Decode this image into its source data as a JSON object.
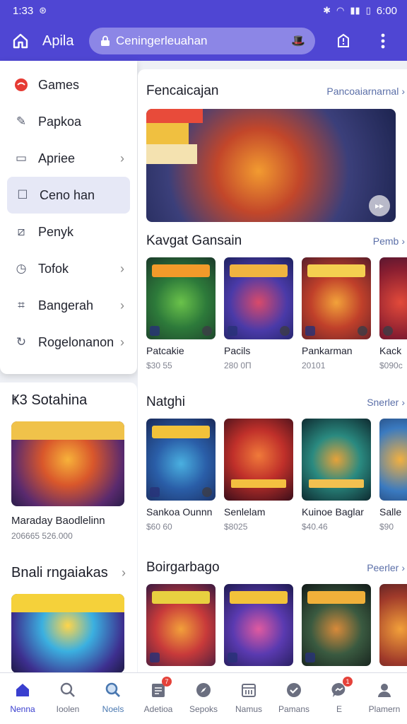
{
  "status": {
    "time": "1:33",
    "clock": "6:00"
  },
  "appbar": {
    "title": "Apila",
    "search_placeholder": "Ceningerleuahan"
  },
  "drawer": {
    "items": [
      {
        "label": "Games",
        "icon": "games-icon",
        "chevron": false
      },
      {
        "label": "Papkoa",
        "icon": "edit-icon",
        "chevron": false
      },
      {
        "label": "Apriee",
        "icon": "window-icon",
        "chevron": true
      },
      {
        "label": "Ceno han",
        "icon": "chat-icon",
        "chevron": false,
        "active": true
      },
      {
        "label": "Penyk",
        "icon": "chart-icon",
        "chevron": false
      },
      {
        "label": "Tofok",
        "icon": "clock-icon",
        "chevron": true
      },
      {
        "label": "Bangerah",
        "icon": "crop-icon",
        "chevron": true
      },
      {
        "label": "Rogelonanon",
        "icon": "refresh-icon",
        "chevron": true
      }
    ]
  },
  "leftcard": {
    "title": "Ҝ3 Sotahina",
    "item_name": "Maraday Baodlelinn",
    "item_meta": "206665  526.000",
    "title2": "Bnali rngaiakas"
  },
  "main": {
    "featured": {
      "title": "Fencaicajan",
      "more": "Pancoaiarnarnal"
    },
    "popular": {
      "title": "Kavgat Gansain",
      "more": "Pemb",
      "items": [
        {
          "name": "Patcakie",
          "price": "$30 55"
        },
        {
          "name": "Pacils",
          "price": "280 0П"
        },
        {
          "name": "Pankarman",
          "price": "20101"
        },
        {
          "name": "Kack",
          "price": "$090c"
        }
      ]
    },
    "new": {
      "title": "Natghi",
      "more": "Snerler",
      "items": [
        {
          "name": "Sankoa Ounnn",
          "price": "$60 60"
        },
        {
          "name": "Senlelam",
          "price": "$8025"
        },
        {
          "name": "Kuinoe Baglar",
          "price": "$40.46"
        },
        {
          "name": "Salle",
          "price": "$90"
        }
      ]
    },
    "more_section": {
      "title": "Boirgarbago",
      "more": "Peerler"
    }
  },
  "nav": [
    {
      "label": "Nenna",
      "icon": "home-icon",
      "active": true
    },
    {
      "label": "Ioolen",
      "icon": "search-icon"
    },
    {
      "label": "Noels",
      "icon": "discover-icon"
    },
    {
      "label": "Adetioa",
      "icon": "document-icon",
      "badge": "7"
    },
    {
      "label": "Sepoks",
      "icon": "compass-icon"
    },
    {
      "label": "Namus",
      "icon": "calendar-icon"
    },
    {
      "label": "Pamans",
      "icon": "check-icon"
    },
    {
      "label": "E",
      "icon": "messenger-icon",
      "badge": "1"
    },
    {
      "label": "Plamern",
      "icon": "profile-icon"
    }
  ],
  "colors": {
    "primary": "#4f46d3",
    "accent": "#3a3fcf",
    "badge": "#e5423a"
  }
}
